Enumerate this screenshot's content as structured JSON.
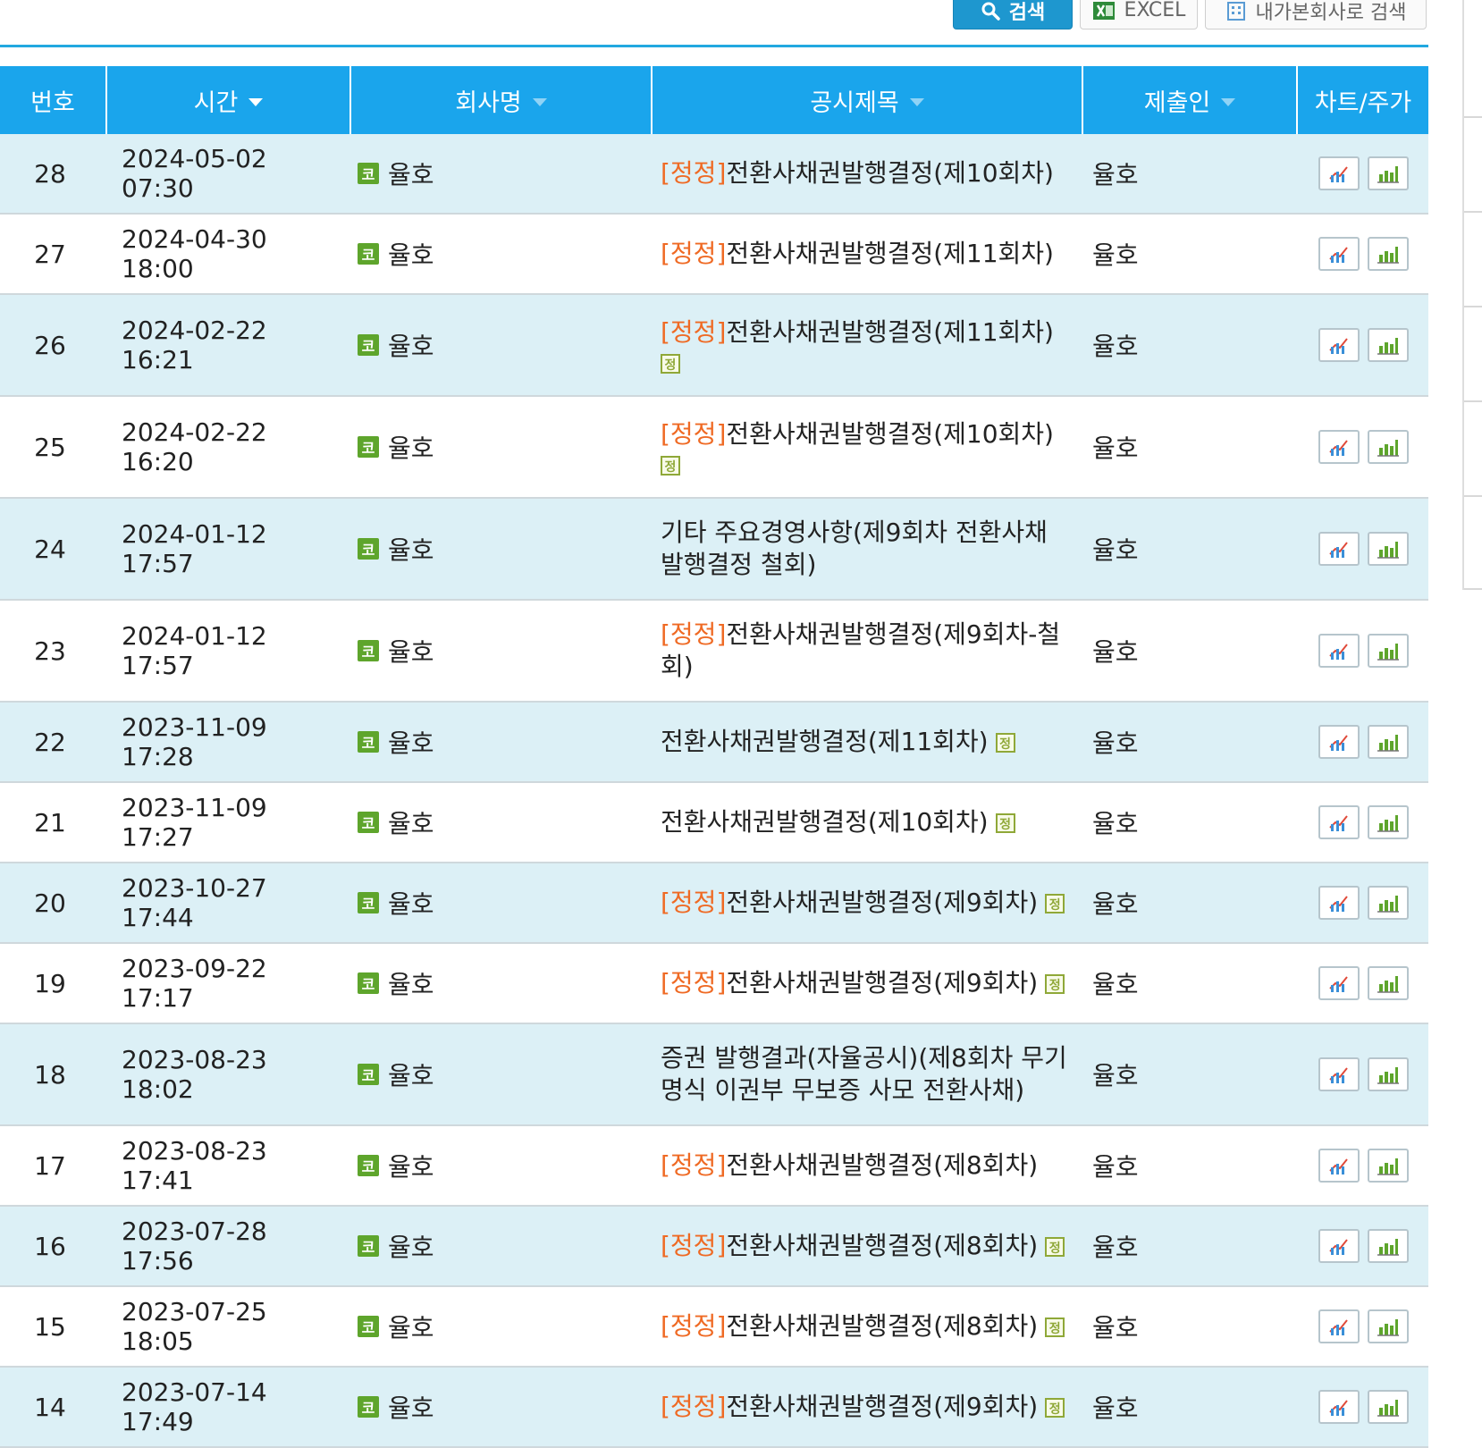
{
  "toolbar": {
    "search_label": "검색",
    "excel_label": "EXCEL",
    "interest_label": "내가본회사로 검색"
  },
  "table": {
    "columns": [
      "번호",
      "시간",
      "회사명",
      "공시제목",
      "제출인",
      "차트/주가"
    ],
    "corp_badge": "코",
    "correction_tag": "[정정]",
    "jeong_badge": "정",
    "rows": [
      {
        "no": "28",
        "time": "2024-05-02 07:30",
        "corp": "율호",
        "title": "전환사채권발행결정(제10회차)",
        "correction": true,
        "badge": false,
        "submitter": "율호"
      },
      {
        "no": "27",
        "time": "2024-04-30 18:00",
        "corp": "율호",
        "title": "전환사채권발행결정(제11회차)",
        "correction": true,
        "badge": false,
        "submitter": "율호"
      },
      {
        "no": "26",
        "time": "2024-02-22 16:21",
        "corp": "율호",
        "title": "전환사채권발행결정(제11회차)",
        "correction": true,
        "badge": true,
        "submitter": "율호"
      },
      {
        "no": "25",
        "time": "2024-02-22 16:20",
        "corp": "율호",
        "title": "전환사채권발행결정(제10회차)",
        "correction": true,
        "badge": true,
        "submitter": "율호"
      },
      {
        "no": "24",
        "time": "2024-01-12 17:57",
        "corp": "율호",
        "title": "기타 주요경영사항(제9회차 전환사채 발행결정 철회)",
        "correction": false,
        "badge": false,
        "submitter": "율호"
      },
      {
        "no": "23",
        "time": "2024-01-12 17:57",
        "corp": "율호",
        "title": "전환사채권발행결정(제9회차-철회)",
        "correction": true,
        "badge": false,
        "submitter": "율호"
      },
      {
        "no": "22",
        "time": "2023-11-09 17:28",
        "corp": "율호",
        "title": "전환사채권발행결정(제11회차)",
        "correction": false,
        "badge": true,
        "submitter": "율호"
      },
      {
        "no": "21",
        "time": "2023-11-09 17:27",
        "corp": "율호",
        "title": "전환사채권발행결정(제10회차)",
        "correction": false,
        "badge": true,
        "submitter": "율호"
      },
      {
        "no": "20",
        "time": "2023-10-27 17:44",
        "corp": "율호",
        "title": "전환사채권발행결정(제9회차)",
        "correction": true,
        "badge": true,
        "submitter": "율호"
      },
      {
        "no": "19",
        "time": "2023-09-22 17:17",
        "corp": "율호",
        "title": "전환사채권발행결정(제9회차)",
        "correction": true,
        "badge": true,
        "submitter": "율호"
      },
      {
        "no": "18",
        "time": "2023-08-23 18:02",
        "corp": "율호",
        "title": "증권 발행결과(자율공시)(제8회차 무기명식 이권부 무보증 사모 전환사채)",
        "correction": false,
        "badge": false,
        "submitter": "율호"
      },
      {
        "no": "17",
        "time": "2023-08-23 17:41",
        "corp": "율호",
        "title": "전환사채권발행결정(제8회차)",
        "correction": true,
        "badge": false,
        "submitter": "율호"
      },
      {
        "no": "16",
        "time": "2023-07-28 17:56",
        "corp": "율호",
        "title": "전환사채권발행결정(제8회차)",
        "correction": true,
        "badge": true,
        "submitter": "율호"
      },
      {
        "no": "15",
        "time": "2023-07-25 18:05",
        "corp": "율호",
        "title": "전환사채권발행결정(제8회차)",
        "correction": true,
        "badge": true,
        "submitter": "율호"
      },
      {
        "no": "14",
        "time": "2023-07-14 17:49",
        "corp": "율호",
        "title": "전환사채권발행결정(제9회차)",
        "correction": true,
        "badge": true,
        "submitter": "율호"
      }
    ]
  },
  "colors": {
    "header_bg": "#1aa5ec",
    "alt_row_bg": "#dcf0f6",
    "correction_text": "#ef6a24",
    "corp_badge_bg": "#5ea52c",
    "search_button_bg": "#1e97cf"
  },
  "icons": {
    "search_button": "magnifier-icon",
    "excel_button": "excel-icon",
    "interest_button": "building-icon",
    "chart_button": "chart-icon",
    "stock_button": "bar-chart-icon"
  }
}
